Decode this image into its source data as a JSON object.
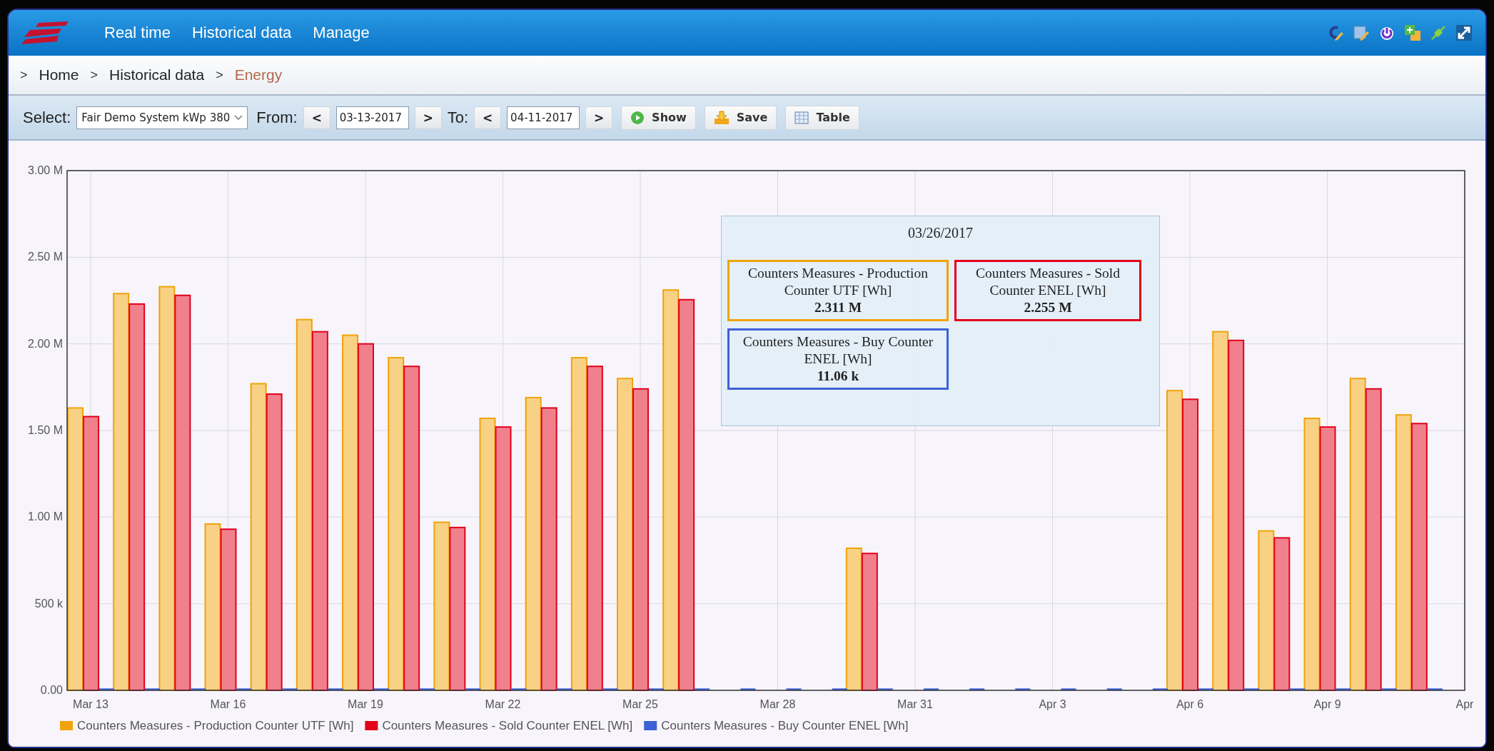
{
  "nav": {
    "menu": [
      {
        "label": "Real time"
      },
      {
        "label": "Historical data"
      },
      {
        "label": "Manage"
      }
    ]
  },
  "breadcrumb": [
    {
      "separator": ">",
      "label": "Home",
      "current": false
    },
    {
      "separator": ">",
      "label": "Historical data",
      "current": false
    },
    {
      "separator": ">",
      "label": "Energy",
      "current": true
    }
  ],
  "toolbar": {
    "select": {
      "label": "Select:",
      "value": "Fair Demo System kWp 380"
    },
    "from": {
      "label": "From:",
      "prev": "<",
      "value": "03-13-2017",
      "next": ">"
    },
    "to": {
      "label": "To:",
      "prev": "<",
      "value": "04-11-2017",
      "next": ">"
    },
    "buttons": [
      {
        "kind": "show",
        "label": "Show"
      },
      {
        "kind": "save",
        "label": "Save"
      },
      {
        "kind": "table",
        "label": "Table"
      }
    ]
  },
  "chart": {
    "chart_data": {
      "type": "bar",
      "categories": [
        "Mar 13",
        null,
        null,
        "Mar 16",
        null,
        null,
        "Mar 19",
        null,
        null,
        "Mar 22",
        null,
        null,
        "Mar 25",
        null,
        null,
        "Mar 28",
        null,
        null,
        "Mar 31",
        null,
        null,
        "Apr 3",
        null,
        null,
        "Apr 6",
        null,
        null,
        "Apr 9",
        null,
        null,
        "Apr"
      ],
      "grid": true,
      "series": [
        {
          "name": "Counters Measures - Production Counter UTF [Wh]",
          "color": "#f0a30a",
          "values": [
            1630000,
            2290000,
            2330000,
            960000,
            1770000,
            2140000,
            2050000,
            1920000,
            970000,
            1570000,
            1690000,
            1920000,
            1800000,
            2311000,
            null,
            null,
            null,
            820000,
            null,
            null,
            null,
            null,
            null,
            null,
            1730000,
            2070000,
            920000,
            1570000,
            1800000,
            1590000,
            null
          ]
        },
        {
          "name": "Counters Measures - Sold Counter ENEL [Wh]",
          "color": "#e3001b",
          "values": [
            1580000,
            2230000,
            2280000,
            930000,
            1710000,
            2070000,
            2000000,
            1870000,
            940000,
            1520000,
            1630000,
            1870000,
            1740000,
            2255000,
            null,
            null,
            null,
            790000,
            null,
            null,
            null,
            null,
            null,
            null,
            1680000,
            2020000,
            880000,
            1520000,
            1740000,
            1540000,
            null
          ]
        },
        {
          "name": "Counters Measures - Buy Counter ENEL [Wh]",
          "color": "#3d62d6",
          "values": [
            11000,
            11000,
            11000,
            11000,
            11000,
            11000,
            11000,
            11000,
            11000,
            11000,
            11000,
            11000,
            11000,
            11000,
            11000,
            11000,
            11000,
            11000,
            11000,
            11000,
            11000,
            11000,
            11000,
            11000,
            11000,
            11000,
            11000,
            11000,
            11000,
            11000,
            null
          ]
        }
      ],
      "ylim": [
        0,
        3000000
      ],
      "yticks": [
        {
          "value": 0,
          "label": "0.00"
        },
        {
          "value": 500000,
          "label": "500 k"
        },
        {
          "value": 1000000,
          "label": "1.00 M"
        },
        {
          "value": 1500000,
          "label": "1.50 M"
        },
        {
          "value": 2000000,
          "label": "2.00 M"
        },
        {
          "value": 2500000,
          "label": "2.50 M"
        },
        {
          "value": 3000000,
          "label": "3.00 M"
        }
      ]
    },
    "tooltip": {
      "title": "03/26/2017",
      "items": [
        {
          "name": "Counters Measures - Production Counter UTF [Wh]",
          "value": "2.311 M",
          "color": "#f0a30a"
        },
        {
          "name": "Counters Measures - Sold Counter ENEL [Wh]",
          "value": "2.255 M",
          "color": "#e3001b"
        },
        {
          "name": "Counters Measures - Buy Counter ENEL [Wh]",
          "value": "11.06 k",
          "color": "#3d62d6"
        }
      ]
    }
  }
}
